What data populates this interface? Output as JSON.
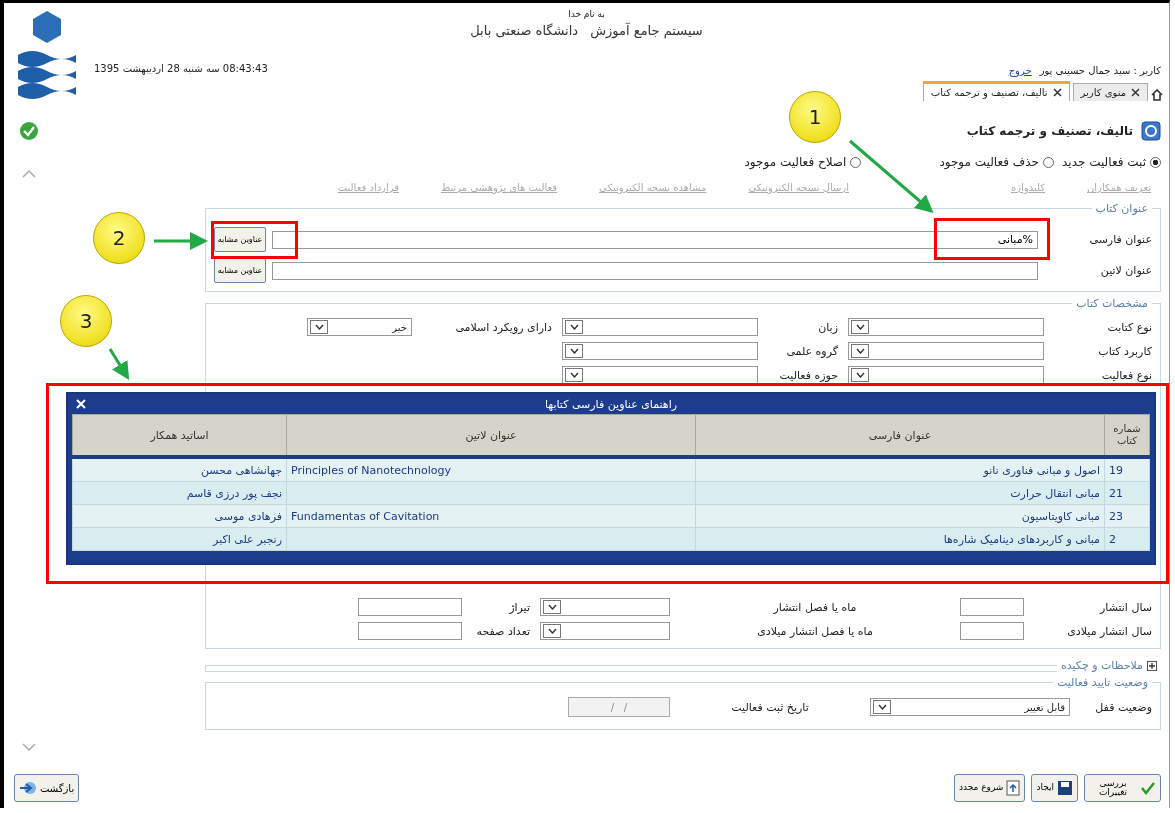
{
  "header": {
    "basmala": "به نام خدا",
    "system_title": "سیستم جامع آموزش",
    "university": "دانشگاه صنعتی بابل",
    "datetime": "08:43:43 سه شنبه 28 اردیبهشت 1395",
    "user": "کاربر : سید جمال حسینی پور",
    "logout": "خروج"
  },
  "tabs": [
    {
      "label": "منوی کاربر",
      "selected": false
    },
    {
      "label": "تالیف، تصنیف و ترجمه کتاب",
      "selected": true
    }
  ],
  "page_title": "تالیف، تصنیف و ترجمه کتاب",
  "modes": [
    {
      "label": "ثبت فعالیت جدید",
      "selected": true
    },
    {
      "label": "حذف فعالیت موجود",
      "selected": false
    },
    {
      "label": "اصلاح فعالیت موجود",
      "selected": false
    }
  ],
  "links": [
    {
      "label": "تعریف همکاران",
      "disabled": true
    },
    {
      "label": "کلیدواژه",
      "disabled": true
    },
    {
      "label": "ارسال نسخه الکترونیکی",
      "disabled": true
    },
    {
      "label": "مشاهده نسخه الکترونیکی",
      "disabled": true
    },
    {
      "label": "فعالیت های پژوهشی مرتبط",
      "disabled": true
    },
    {
      "label": "قرارداد فعالیت",
      "disabled": true
    }
  ],
  "title_section": {
    "legend": "عنوان کتاب",
    "fields": [
      {
        "label": "عنوان فارسی",
        "value": "%مبانی",
        "button": "عناوین مشابه"
      },
      {
        "label": "عنوان لاتین",
        "button": "عناوین مشابه"
      }
    ]
  },
  "specs_section": {
    "legend": "مشخصات کتاب",
    "rows": [
      [
        {
          "label": "نوع کتابت",
          "kind": "select"
        },
        {
          "label": "زبان",
          "kind": "select"
        },
        {
          "label": "دارای رویکرد اسلامی",
          "kind": "select",
          "value": "خیر"
        }
      ],
      [
        {
          "label": "کاربرد کتاب",
          "kind": "select"
        },
        {
          "label": "گروه علمی",
          "kind": "select"
        }
      ],
      [
        {
          "label": "نوع فعالیت",
          "kind": "select"
        },
        {
          "label": "حوزه فعالیت",
          "kind": "select"
        }
      ]
    ],
    "lower_rows": [
      [
        {
          "label": "سال انتشار",
          "kind": "input"
        },
        {
          "label": "ماه یا فصل انتشار",
          "kind": "select"
        },
        {
          "label": "تیراژ",
          "kind": "input"
        }
      ],
      [
        {
          "label": "سال انتشار میلادی",
          "kind": "input"
        },
        {
          "label": "ماه یا فصل انتشار میلادی",
          "kind": "select"
        },
        {
          "label": "تعداد صفحه",
          "kind": "input"
        }
      ]
    ]
  },
  "notes_section": {
    "label": "ملاحظات و چکیده",
    "expanded": false
  },
  "status_section": {
    "legend": "وضعیت تایید فعالیت",
    "lock_label": "وضعیت قفل",
    "lock_value": "قابل تغییر",
    "date_label": "تاریخ ثبت فعالیت",
    "date_value": "/   /"
  },
  "popup": {
    "title": "راهنمای عناوین فارسی کتابها",
    "columns": [
      "شماره کتاب",
      "عنوان فارسی",
      "عنوان لاتین",
      "اساتید همکار"
    ],
    "rows": [
      [
        "19",
        "اصول و مبانی فناوری نانو",
        "Principles of Nanotechnology",
        "جهانشاهی محسن"
      ],
      [
        "21",
        "مبانی انتقال حرارت",
        "",
        "نجف پور درزی قاسم"
      ],
      [
        "23",
        "مبانی کاویتاسیون",
        "Fundamentas of Cavitation",
        "فرهادی موسی"
      ],
      [
        "2",
        "مبانی و کاربردهای دینامیک شاره‌ها",
        "",
        "رنجبر علی اکبر"
      ]
    ]
  },
  "buttons": [
    {
      "label": "بررسی تغییرات",
      "kind": "review"
    },
    {
      "label": "ایجاد",
      "kind": "save"
    },
    {
      "label": "شروع مجدد",
      "kind": "restart"
    }
  ],
  "back_button": "بازگشت",
  "annotations": [
    {
      "label": "1"
    },
    {
      "label": "2"
    },
    {
      "label": "3"
    }
  ]
}
